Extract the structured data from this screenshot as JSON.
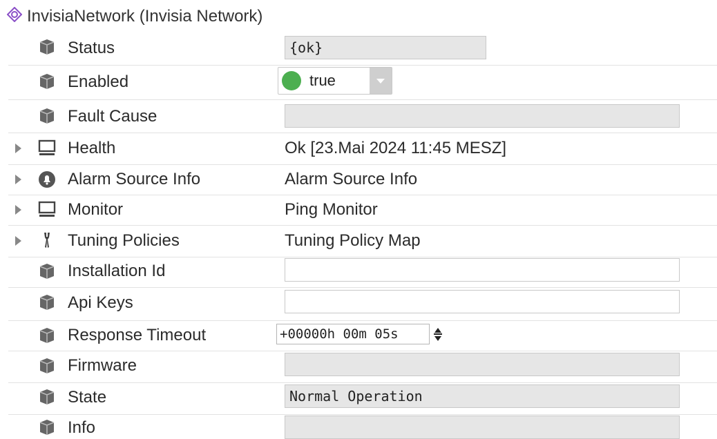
{
  "header": {
    "title": "InvisiaNetwork  (Invisia Network)",
    "icon": "network-logo-icon"
  },
  "colors": {
    "accent": "#8a4fc7",
    "enabled_dot": "#4caf50",
    "field_bg": "#e6e6e6"
  },
  "rows": [
    {
      "label": "Status",
      "icon": "property-slot-icon",
      "value": "{ok}"
    },
    {
      "label": "Enabled",
      "icon": "property-slot-icon",
      "value": "true"
    },
    {
      "label": "Fault Cause",
      "icon": "property-slot-icon",
      "value": ""
    },
    {
      "label": "Health",
      "icon": "monitor-icon",
      "value": "Ok [23.Mai 2024 11:45 MESZ]"
    },
    {
      "label": "Alarm Source Info",
      "icon": "alarm-bell-icon",
      "value": "Alarm Source Info"
    },
    {
      "label": "Monitor",
      "icon": "monitor-icon",
      "value": "Ping Monitor"
    },
    {
      "label": "Tuning Policies",
      "icon": "wrench-icon",
      "value": "Tuning Policy Map"
    },
    {
      "label": "Installation Id",
      "icon": "property-slot-icon",
      "value": ""
    },
    {
      "label": "Api Keys",
      "icon": "property-slot-icon",
      "value": ""
    },
    {
      "label": "Response Timeout",
      "icon": "property-slot-icon",
      "value": "+00000h 00m 05s"
    },
    {
      "label": "Firmware",
      "icon": "property-slot-icon",
      "value": ""
    },
    {
      "label": "State",
      "icon": "property-slot-icon",
      "value": "Normal Operation"
    },
    {
      "label": "Info",
      "icon": "property-slot-icon",
      "value": ""
    }
  ]
}
